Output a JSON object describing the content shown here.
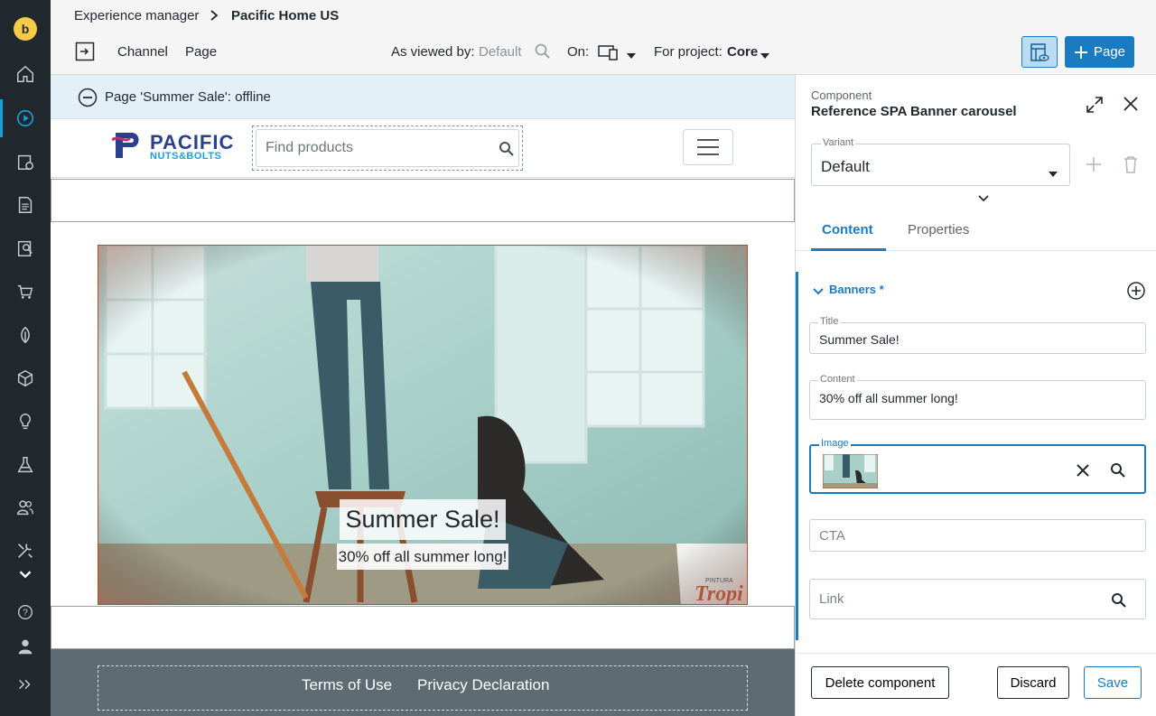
{
  "breadcrumb": {
    "root": "Experience manager",
    "current": "Pacific Home US"
  },
  "toolbar": {
    "channel": "Channel",
    "page": "Page",
    "viewed_by_label": "As viewed by:",
    "viewed_by_value": "Default",
    "on_label": "On:",
    "project_label": "For project:",
    "project_value": "Core",
    "add_page_label": "Page"
  },
  "canvas": {
    "offline_text": "Page 'Summer Sale': offline",
    "logo_top": "PACIFIC",
    "logo_bottom": "NUTS&BOLTS",
    "search_placeholder": "Find products",
    "banner_title": "Summer Sale!",
    "banner_subtitle": "30% off all summer long!",
    "banner_sign": "Tropi",
    "banner_sign_small": "PINTURA",
    "footer_links": [
      "Terms of Use",
      "Privacy Declaration"
    ]
  },
  "panel": {
    "kind": "Component",
    "title": "Reference SPA Banner carousel",
    "variant_label": "Variant",
    "variant_value": "Default",
    "tabs": [
      "Content",
      "Properties"
    ],
    "section": "Banners *",
    "fields": {
      "title_label": "Title",
      "title_value": "Summer Sale!",
      "content_label": "Content",
      "content_value": "30% off all summer long!",
      "image_label": "Image",
      "cta_placeholder": "CTA",
      "link_placeholder": "Link"
    },
    "buttons": {
      "delete": "Delete component",
      "discard": "Discard",
      "save": "Save"
    }
  },
  "colors": {
    "accent": "#1a7bc1",
    "rail": "#22292e",
    "badge": "#f7c948",
    "offline_bar": "#e3f0f8",
    "footer": "#5f6b73"
  },
  "icons": [
    "brand-logo-icon",
    "home-icon",
    "experience-manager-icon",
    "projects-icon",
    "content-icon",
    "content-search-icon",
    "commerce-icon",
    "seo-icon",
    "categories-icon",
    "insights-icon",
    "experiments-icon",
    "audiences-icon",
    "admin-icon",
    "help-icon",
    "user-icon"
  ]
}
